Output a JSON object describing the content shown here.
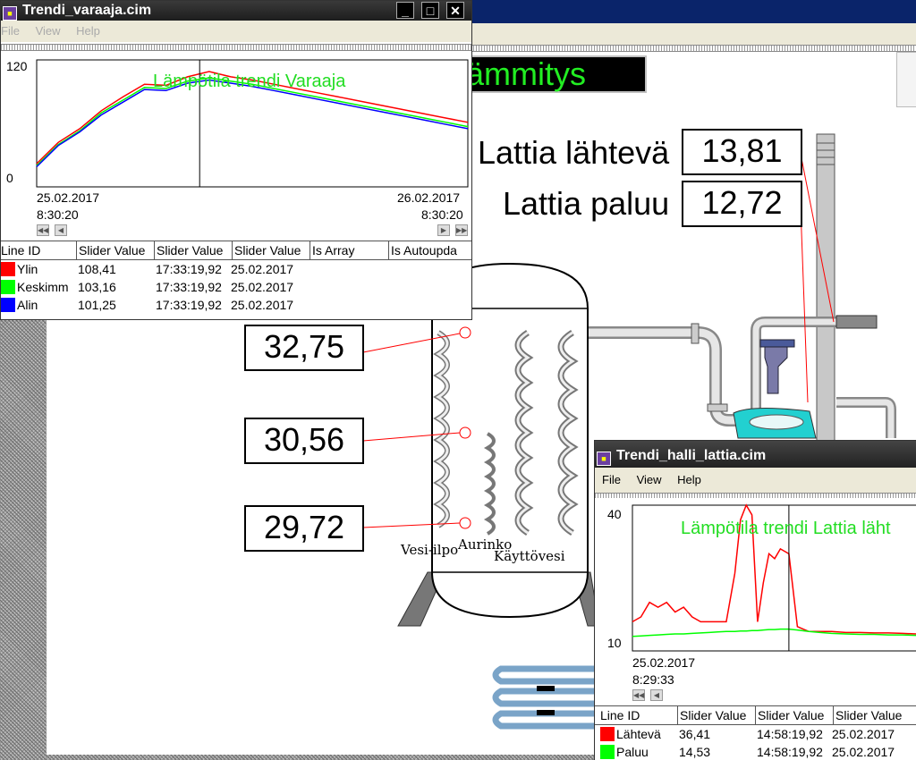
{
  "scene": {
    "header_title": "ämmitys",
    "floor_out_label": "Lattia lähtevä",
    "floor_out_value": "13,81",
    "floor_return_label": "Lattia paluu",
    "floor_return_value": "12,72",
    "tank_temps": [
      "32,75",
      "30,56",
      "29,72"
    ],
    "tank_labels": {
      "vesi_ilpo": "Vesi-ilpo",
      "aurinko": "Aurinko",
      "kayttovesi": "Käyttövesi"
    }
  },
  "win_varaaja": {
    "title": "Trendi_varaaja.cim",
    "menu": [
      "File",
      "View",
      "Help"
    ],
    "chart_title": "Lämpötila trendi Varaaja",
    "y_max": "120",
    "y_min": "0",
    "x_start_date": "25.02.2017",
    "x_start_time": "8:30:20",
    "x_end_date": "26.02.2017",
    "x_end_time": "8:30:20",
    "columns": [
      "Line ID",
      "Slider Value",
      "Slider Value",
      "Slider Value",
      "Is Array",
      "Is Autoupda"
    ],
    "rows": [
      {
        "id": "Ylin",
        "v1": "108,41",
        "v2": "17:33:19,92",
        "v3": "25.02.2017",
        "color": "#ff0000"
      },
      {
        "id": "Keskimm",
        "v1": "103,16",
        "v2": "17:33:19,92",
        "v3": "25.02.2017",
        "color": "#00ff00"
      },
      {
        "id": "Alin",
        "v1": "101,25",
        "v2": "17:33:19,92",
        "v3": "25.02.2017",
        "color": "#0000ff"
      }
    ]
  },
  "win_lattia": {
    "title": "Trendi_halli_lattia.cim",
    "menu": [
      "File",
      "View",
      "Help"
    ],
    "chart_title": "Lämpötila trendi Lattia läht",
    "y_max": "40",
    "y_min": "10",
    "x_start_date": "25.02.2017",
    "x_start_time": "8:29:33",
    "columns": [
      "Line ID",
      "Slider Value",
      "Slider Value",
      "Slider Value"
    ],
    "rows": [
      {
        "id": "Lähtevä",
        "v1": "36,41",
        "v2": "14:58:19,92",
        "v3": "25.02.2017",
        "color": "#ff0000"
      },
      {
        "id": "Paluu",
        "v1": "14,53",
        "v2": "14:58:19,92",
        "v3": "25.02.2017",
        "color": "#00ff00"
      }
    ]
  },
  "chart_data": [
    {
      "type": "line",
      "title": "Lämpötila trendi Varaaja",
      "ylim": [
        0,
        120
      ],
      "x": [
        0,
        0.05,
        0.1,
        0.15,
        0.2,
        0.25,
        0.3,
        0.35,
        0.4,
        0.45,
        0.5,
        0.55,
        0.6,
        0.65,
        0.7,
        0.75,
        0.8,
        0.85,
        0.9,
        0.95,
        1.0
      ],
      "x_range_labels": [
        "25.02.2017 8:30:20",
        "26.02.2017 8:30:20"
      ],
      "series": [
        {
          "name": "Ylin",
          "color": "#ff0000",
          "values": [
            22,
            42,
            55,
            72,
            85,
            97,
            96,
            104,
            109,
            104,
            101,
            97,
            93,
            89,
            85,
            81,
            77,
            73,
            69,
            65,
            61
          ]
        },
        {
          "name": "Keskimm",
          "color": "#00ff00",
          "values": [
            20,
            40,
            53,
            70,
            82,
            94,
            93,
            100,
            103,
            100,
            97,
            93,
            89,
            85,
            81,
            77,
            73,
            69,
            65,
            61,
            57
          ]
        },
        {
          "name": "Alin",
          "color": "#0000ff",
          "values": [
            19,
            39,
            52,
            68,
            80,
            92,
            91,
            98,
            101,
            98,
            95,
            91,
            87,
            83,
            79,
            75,
            71,
            67,
            63,
            59,
            55
          ]
        }
      ]
    },
    {
      "type": "line",
      "title": "Lämpötila trendi Lattia läht",
      "ylim": [
        10,
        40
      ],
      "x": [
        0,
        0.03,
        0.06,
        0.09,
        0.12,
        0.15,
        0.18,
        0.21,
        0.24,
        0.27,
        0.3,
        0.33,
        0.36,
        0.38,
        0.4,
        0.42,
        0.44,
        0.46,
        0.48,
        0.5,
        0.52,
        0.55,
        0.58,
        0.62,
        0.66,
        0.7,
        0.75,
        0.8,
        0.85,
        0.9,
        0.95,
        1.0
      ],
      "x_range_labels": [
        "25.02.2017 8:29:33"
      ],
      "series": [
        {
          "name": "Lähtevä",
          "color": "#ff0000",
          "values": [
            16,
            17,
            20,
            19,
            20,
            18,
            19,
            17,
            16,
            16,
            16,
            16,
            26,
            37,
            40,
            38,
            16,
            24,
            30,
            29,
            31,
            30,
            15,
            14,
            14,
            14,
            13.8,
            13.8,
            13.7,
            13.7,
            13.6,
            13.5
          ]
        },
        {
          "name": "Paluu",
          "color": "#00ff00",
          "values": [
            13,
            13.1,
            13.2,
            13.3,
            13.4,
            13.5,
            13.5,
            13.6,
            13.7,
            13.8,
            13.9,
            14.0,
            14.0,
            14.1,
            14.1,
            14.2,
            14.2,
            14.3,
            14.4,
            14.4,
            14.5,
            14.5,
            14.3,
            14.0,
            13.8,
            13.6,
            13.5,
            13.4,
            13.4,
            13.3,
            13.3,
            13.2
          ]
        }
      ]
    }
  ]
}
